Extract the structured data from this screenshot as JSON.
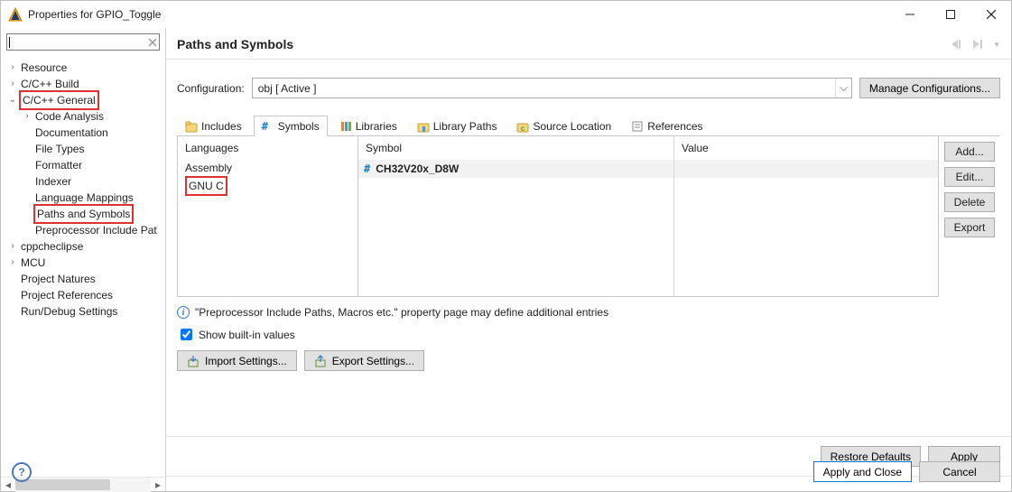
{
  "window": {
    "title": "Properties for GPIO_Toggle"
  },
  "tree": {
    "items": [
      {
        "label": "Resource",
        "indent": 1,
        "tw": ">"
      },
      {
        "label": "C/C++ Build",
        "indent": 1,
        "tw": ">"
      },
      {
        "label": "C/C++ General",
        "indent": 1,
        "tw": "v",
        "hl": true
      },
      {
        "label": "Code Analysis",
        "indent": 2,
        "tw": ">"
      },
      {
        "label": "Documentation",
        "indent": 2,
        "tw": ""
      },
      {
        "label": "File Types",
        "indent": 2,
        "tw": ""
      },
      {
        "label": "Formatter",
        "indent": 2,
        "tw": ""
      },
      {
        "label": "Indexer",
        "indent": 2,
        "tw": ""
      },
      {
        "label": "Language Mappings",
        "indent": 2,
        "tw": ""
      },
      {
        "label": "Paths and Symbols",
        "indent": 2,
        "tw": "",
        "hl": true
      },
      {
        "label": "Preprocessor Include Pat",
        "indent": 2,
        "tw": ""
      },
      {
        "label": "cppcheclipse",
        "indent": 1,
        "tw": ">"
      },
      {
        "label": "MCU",
        "indent": 1,
        "tw": ">"
      },
      {
        "label": "Project Natures",
        "indent": 1,
        "tw": ""
      },
      {
        "label": "Project References",
        "indent": 1,
        "tw": ""
      },
      {
        "label": "Run/Debug Settings",
        "indent": 1,
        "tw": ""
      }
    ]
  },
  "page": {
    "title": "Paths and Symbols",
    "config_label": "Configuration:",
    "config_value": "obj  [ Active ]",
    "manage_btn": "Manage Configurations...",
    "tabs": [
      {
        "label": "Includes",
        "active": false
      },
      {
        "label": "Symbols",
        "active": true,
        "hl": true
      },
      {
        "label": "Libraries",
        "active": false
      },
      {
        "label": "Library Paths",
        "active": false
      },
      {
        "label": "Source Location",
        "active": false
      },
      {
        "label": "References",
        "active": false
      }
    ],
    "languages_header": "Languages",
    "languages": [
      {
        "label": "Assembly",
        "sel": false
      },
      {
        "label": "GNU C",
        "sel": true
      }
    ],
    "symbol_header": "Symbol",
    "value_header": "Value",
    "symbols": [
      {
        "name": "CH32V20x_D8W",
        "value": ""
      }
    ],
    "actions": {
      "add": "Add...",
      "edit": "Edit...",
      "delete": "Delete",
      "export": "Export"
    },
    "info_text": "\"Preprocessor Include Paths, Macros etc.\" property page may define additional entries",
    "show_builtin": "Show built-in values",
    "import_btn": "Import Settings...",
    "export_btn": "Export Settings...",
    "restore_btn": "Restore Defaults",
    "apply_btn": "Apply"
  },
  "footer": {
    "apply_close": "Apply and Close",
    "cancel": "Cancel"
  }
}
